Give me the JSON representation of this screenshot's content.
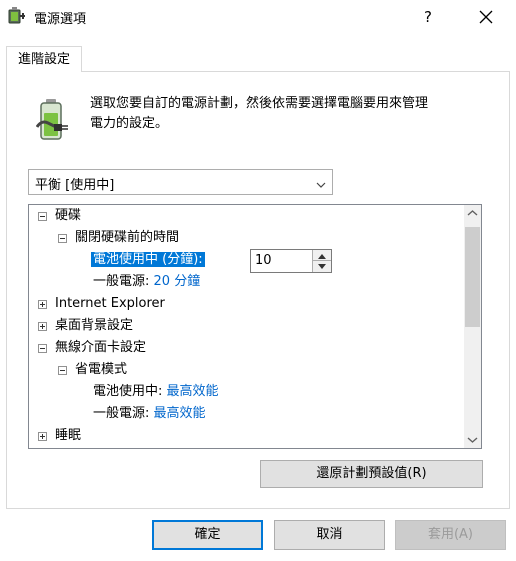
{
  "window": {
    "title": "電源選項",
    "help_label": "?",
    "close_icon": "close-icon",
    "app_icon": "power-options-icon"
  },
  "tab": {
    "label": "進階設定"
  },
  "description": {
    "line1": "選取您要自訂的電源計劃，然後依需要選擇電腦要用來管理",
    "line2": "電力的設定。",
    "icon": "battery-plug-icon"
  },
  "plan_combo": {
    "value": "平衡 [使用中]"
  },
  "tree": {
    "hard_disk": {
      "label": "硬碟",
      "turn_off": {
        "label": "關閉硬碟前的時間",
        "on_battery_label": "電池使用中 (分鐘):",
        "on_battery_value": "10",
        "plugged_label": "一般電源:",
        "plugged_value": "20 分鐘"
      }
    },
    "ie": {
      "label": "Internet Explorer"
    },
    "desktop_bg": {
      "label": "桌面背景設定"
    },
    "wireless": {
      "label": "無線介面卡設定",
      "power_mode": {
        "label": "省電模式",
        "on_battery_label": "電池使用中:",
        "on_battery_value": "最高效能",
        "plugged_label": "一般電源:",
        "plugged_value": "最高效能"
      }
    },
    "sleep": {
      "label": "睡眠"
    }
  },
  "buttons": {
    "restore": "還原計劃預設值(R)",
    "ok": "確定",
    "cancel": "取消",
    "apply": "套用(A)"
  },
  "colors": {
    "selection": "#0078d7",
    "link": "#0066cc",
    "default_button_border": "#0078d7"
  }
}
